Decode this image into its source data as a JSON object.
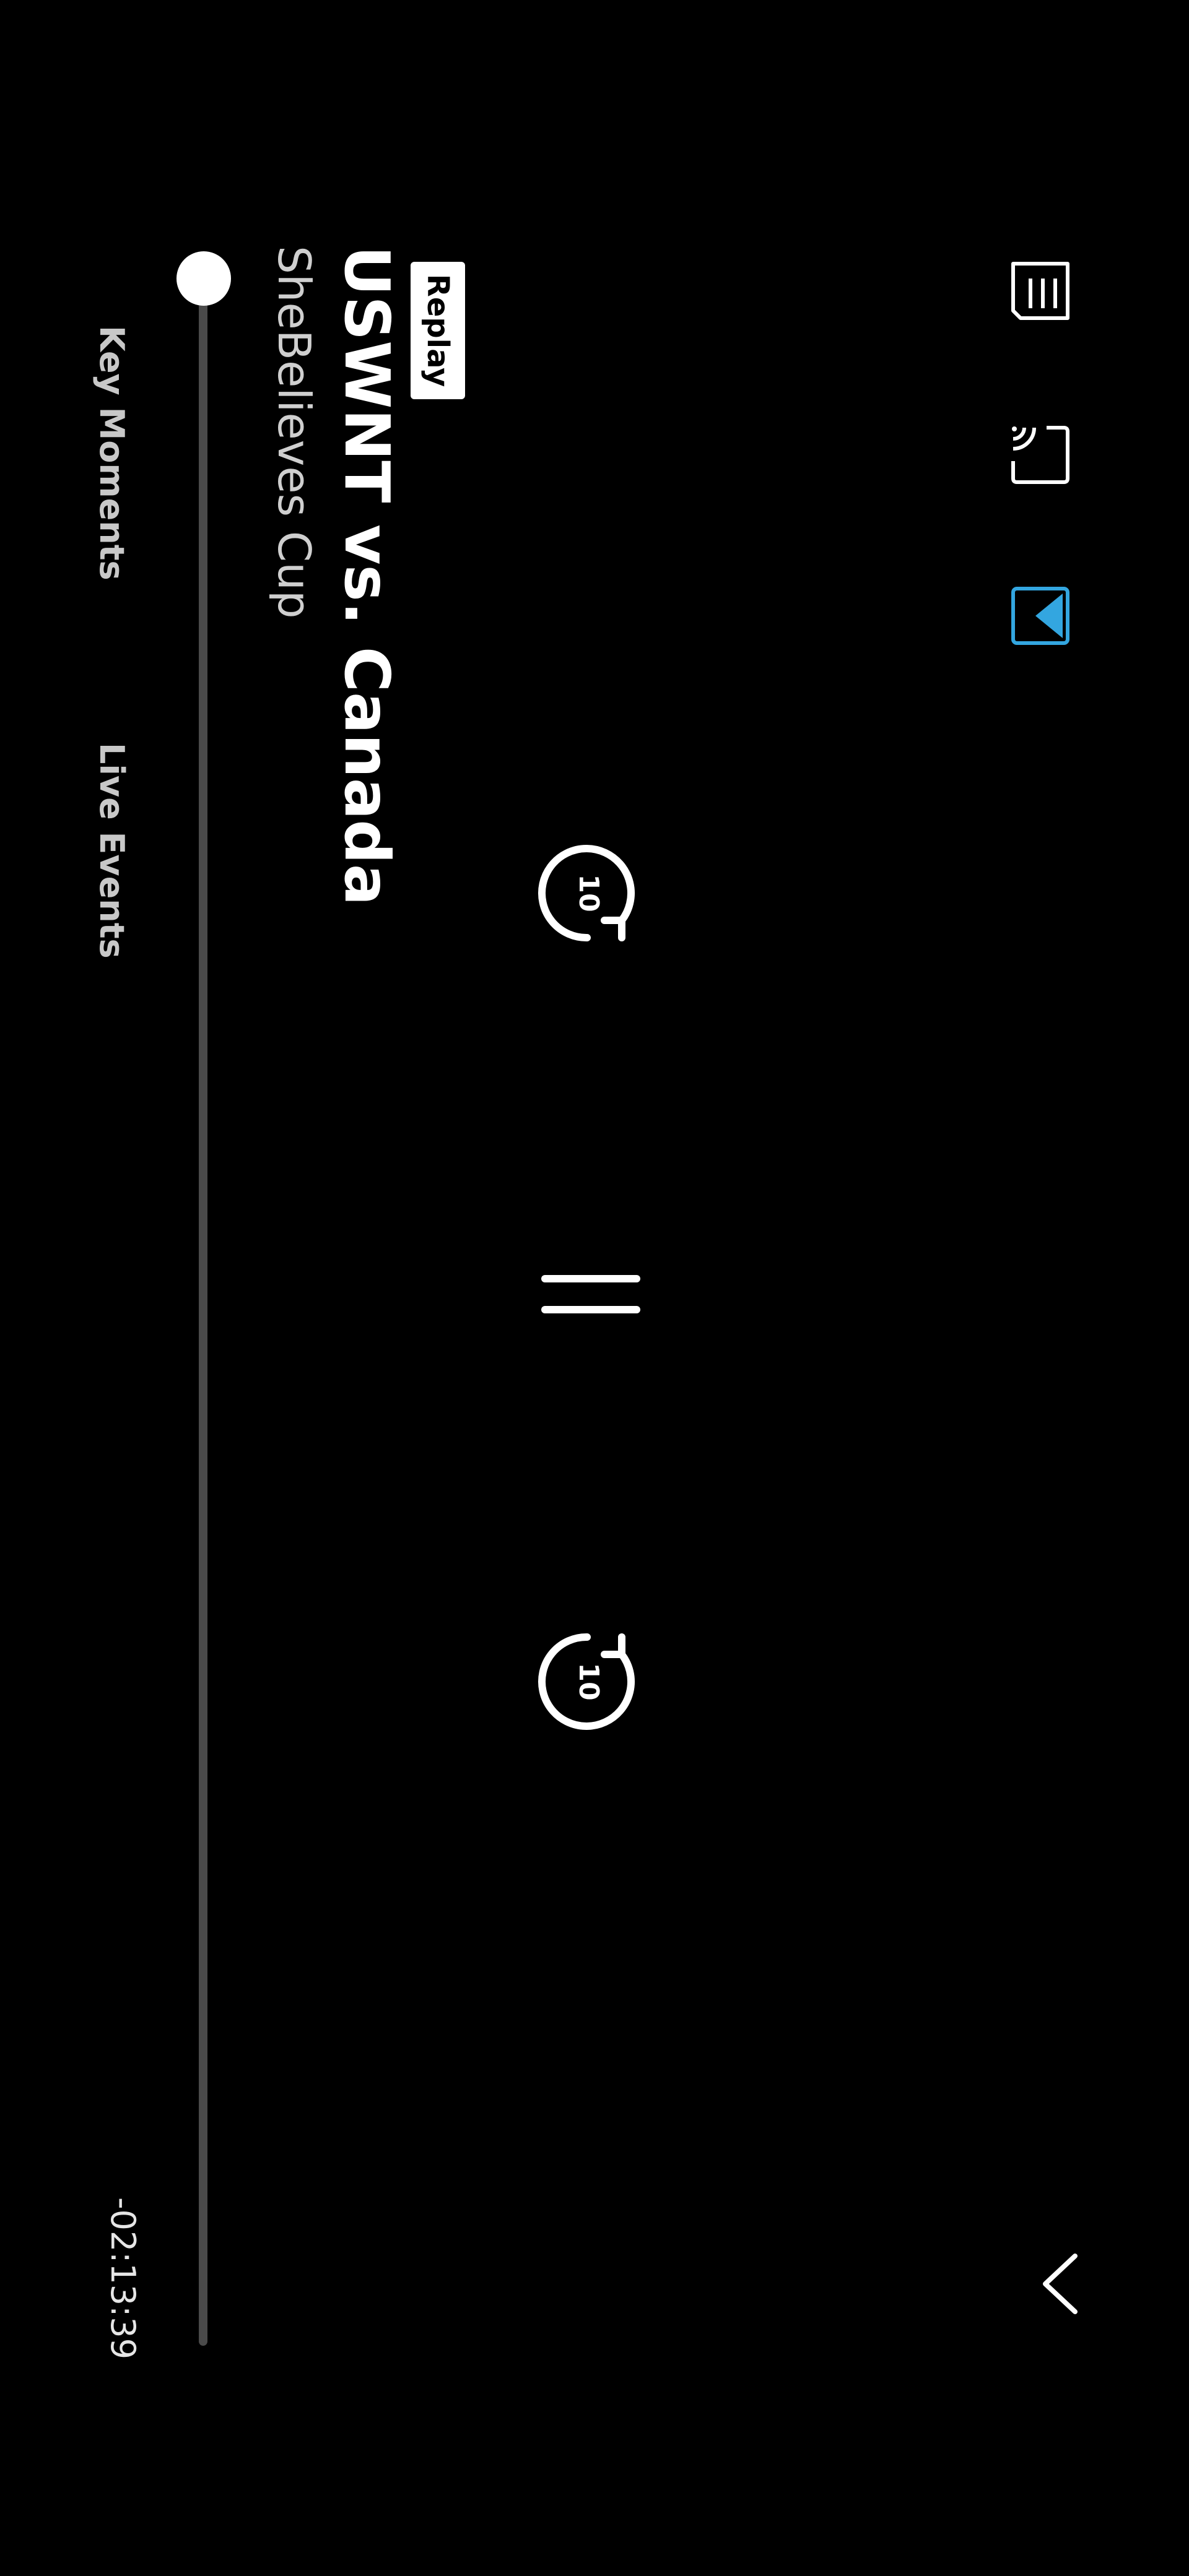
{
  "badge": {
    "label": "Replay"
  },
  "event": {
    "title": "USWNT vs. Canada",
    "subtitle": "SheBelieves Cup"
  },
  "playback": {
    "remaining_time": "-02:13:39",
    "progress": 0.0,
    "skip_back_seconds": "10",
    "skip_forward_seconds": "10",
    "state": "playing"
  },
  "tabs": [
    {
      "label": "Key Moments"
    },
    {
      "label": "Live Events"
    }
  ],
  "icons": {
    "collapse": "chevron-down-icon",
    "picture_in_picture": "picture-in-picture-icon",
    "cast": "cast-icon",
    "info": "info-panel-icon",
    "skip_back": "replay-10-icon",
    "pause": "pause-icon",
    "skip_forward": "forward-10-icon"
  },
  "colors": {
    "background": "#000000",
    "accent": "#33a6e0",
    "text": "#ffffff",
    "track": "#4a4a4a"
  }
}
